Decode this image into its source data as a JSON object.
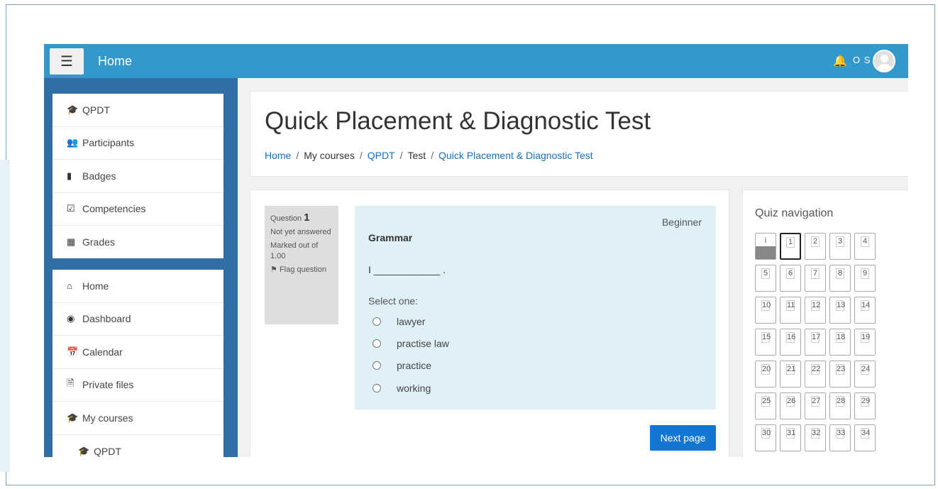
{
  "navbar": {
    "menu_icon": "hamburger-icon",
    "title": "Home",
    "user_initials": "O S"
  },
  "sidebar": {
    "course_items": [
      {
        "icon": "graduation-cap-icon",
        "label": "QPDT"
      },
      {
        "icon": "users-icon",
        "label": "Participants"
      },
      {
        "icon": "shield-icon",
        "label": "Badges"
      },
      {
        "icon": "checkbox-icon",
        "label": "Competencies"
      },
      {
        "icon": "table-icon",
        "label": "Grades"
      }
    ],
    "site_items": [
      {
        "icon": "home-icon",
        "label": "Home"
      },
      {
        "icon": "dashboard-icon",
        "label": "Dashboard"
      },
      {
        "icon": "calendar-icon",
        "label": "Calendar"
      },
      {
        "icon": "file-icon",
        "label": "Private files"
      },
      {
        "icon": "graduation-cap-icon",
        "label": "My courses"
      },
      {
        "icon": "graduation-cap-icon",
        "label": "QPDT"
      }
    ]
  },
  "header": {
    "title": "Quick Placement & Diagnostic Test",
    "breadcrumb": [
      "Home",
      "My courses",
      "QPDT",
      "Test",
      "Quick Placement & Diagnostic Test"
    ]
  },
  "question": {
    "label": "Question",
    "number": "1",
    "status": "Not yet answered",
    "marks": "Marked out of 1.00",
    "flag": "Flag question",
    "level": "Beginner",
    "category": "Grammar",
    "text": "I ____________ .",
    "prompt": "Select one:",
    "options": [
      "lawyer",
      "practise law",
      "practice",
      "working"
    ],
    "next_button": "Next page"
  },
  "quiz_nav": {
    "title": "Quiz navigation",
    "info_label": "i",
    "items": [
      "1",
      "2",
      "3",
      "4",
      "5",
      "6",
      "7",
      "8",
      "9",
      "10",
      "11",
      "12",
      "13",
      "14",
      "15",
      "16",
      "17",
      "18",
      "19",
      "20",
      "21",
      "22",
      "23",
      "24",
      "25",
      "26",
      "27",
      "28",
      "29",
      "30",
      "31",
      "32",
      "33",
      "34"
    ],
    "current": "1"
  }
}
